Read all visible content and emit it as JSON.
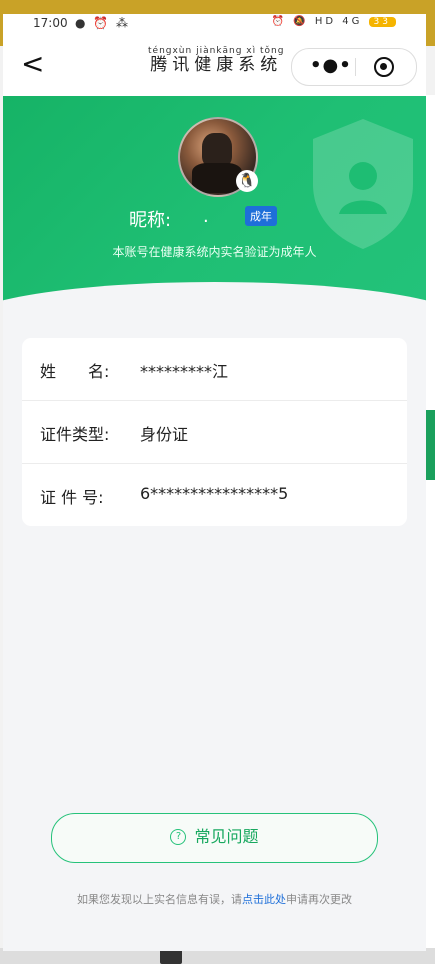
{
  "status_bar": {
    "time": "17:00",
    "left_indicators": "● ⏰ ⁂",
    "right_indicators": "⏰ 🔕 HD 4G",
    "battery": "33"
  },
  "nav": {
    "back_glyph": "<",
    "title_pinyin": "téngxùn jiànkāng xì tǒng",
    "title": "腾讯健康系统",
    "more_glyph": "•●•"
  },
  "profile": {
    "nickname_label": "昵称:",
    "nickname_value": ".",
    "badge": "成年",
    "subtitle": "本账号在健康系统内实名验证为成年人"
  },
  "info": {
    "rows": [
      {
        "label": "姓　　名:",
        "value": "*********江"
      },
      {
        "label": "证件类型:",
        "value": "身份证"
      },
      {
        "label": "证 件 号:",
        "value": "6****************5"
      }
    ]
  },
  "faq_button": {
    "icon": "?",
    "label": "常见问题"
  },
  "footer_note": {
    "prefix": "如果您发现以上实名信息有误，请",
    "link": "点击此处",
    "suffix": "申请再次更改"
  },
  "colors": {
    "accent_green": "#1fbf74",
    "badge_blue": "#1e6fd9"
  }
}
